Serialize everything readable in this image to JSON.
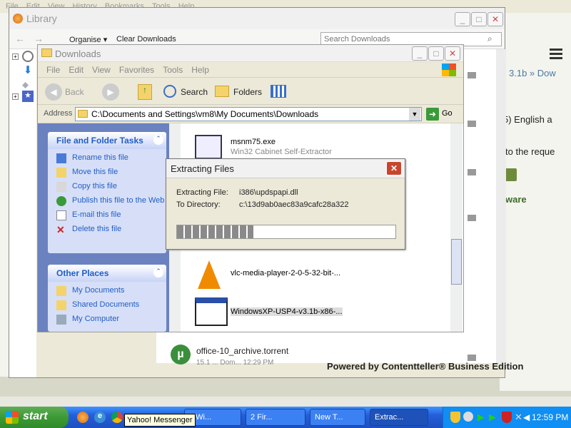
{
  "background_browser": {
    "menu": [
      "File",
      "Edit",
      "View",
      "History",
      "Bookmarks",
      "Tools",
      "Help"
    ],
    "breadcrumb": "3.1b » Dow",
    "text1": "5) English a",
    "text2": "to the reque",
    "text3": "ware",
    "powered_by": "Powered by Contentteller® Business Edition"
  },
  "library": {
    "title": "Library",
    "organise": "Organise ▾",
    "clear_downloads": "Clear Downloads",
    "search_placeholder": "Search Downloads",
    "office_item": "office-10_archive.torrent",
    "office_sub": "15.1 ... Dom... 12:29 PM"
  },
  "explorer": {
    "title": "Downloads",
    "menu": [
      "File",
      "Edit",
      "View",
      "Favorites",
      "Tools",
      "Help"
    ],
    "back": "Back",
    "search": "Search",
    "folders": "Folders",
    "address_label": "Address",
    "address": "C:\\Documents and Settings\\vm8\\My Documents\\Downloads",
    "go": "Go",
    "file_tasks_title": "File and Folder Tasks",
    "file_tasks": [
      "Rename this file",
      "Move this file",
      "Copy this file",
      "Publish this file to the Web",
      "E-mail this file",
      "Delete this file"
    ],
    "other_places_title": "Other Places",
    "other_places": [
      "My Documents",
      "Shared Documents",
      "My Computer"
    ],
    "files": [
      {
        "name": "msnm75.exe",
        "desc": "Win32 Cabinet Self-Extractor"
      },
      {
        "name": "vlc-media-player-2-0-5-32-bit-...",
        "desc": ""
      },
      {
        "name": "WindowsXP-USP4-v3.1b-x86-...",
        "desc": ""
      }
    ]
  },
  "dialog": {
    "title": "Extracting Files",
    "extracting_label": "Extracting File:",
    "extracting_value": "i386\\updspapi.dll",
    "directory_label": "To Directory:",
    "directory_value": "c:\\13d9ab0aec83a9cafc28a322",
    "progress_percent": 35
  },
  "taskbar": {
    "start": "start",
    "tooltip": "Yahoo! Messenger",
    "buttons": [
      "2 Wi...",
      "2 Fir...",
      "New T...",
      "Extrac..."
    ],
    "clock": "12:59 PM"
  }
}
